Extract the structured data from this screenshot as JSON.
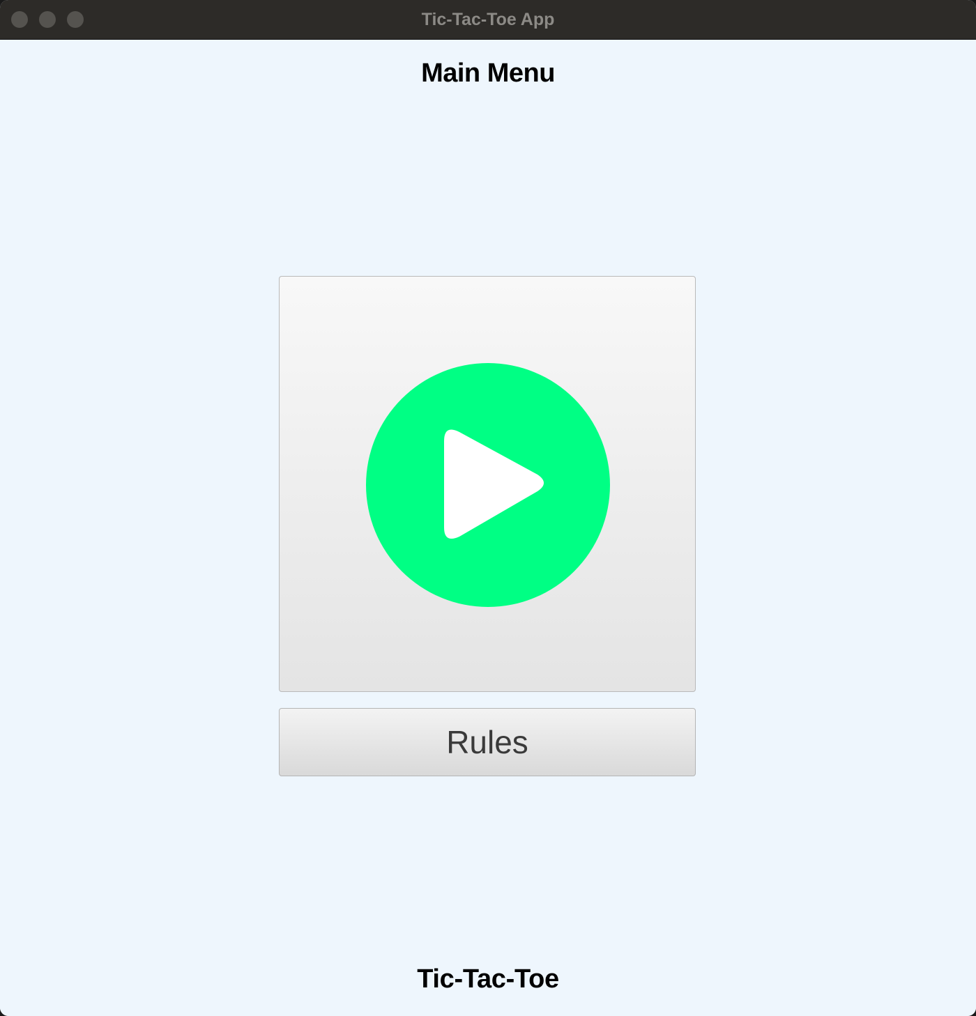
{
  "window": {
    "title": "Tic-Tac-Toe App"
  },
  "main": {
    "heading": "Main Menu",
    "play_button": {
      "icon": "play-circle-icon",
      "icon_color": "#00ff84"
    },
    "rules_label": "Rules"
  },
  "footer": {
    "label": "Tic-Tac-Toe"
  }
}
